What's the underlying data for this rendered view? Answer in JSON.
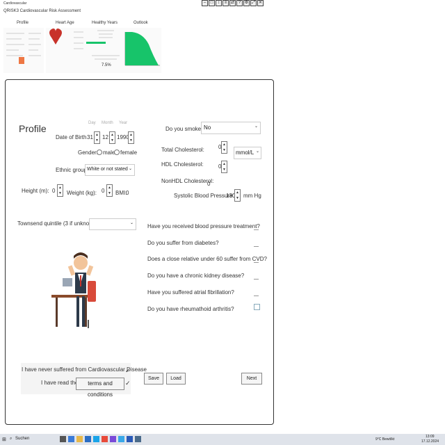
{
  "window": {
    "title": "Cardiovascular",
    "subtitle": "QRISK3 Cardiovascular Risk Assessment"
  },
  "thumbnails": [
    {
      "label": "Profile"
    },
    {
      "label": "Heart Age"
    },
    {
      "label": "Healthy Years"
    },
    {
      "label": "Outlook"
    }
  ],
  "healthy_years_value": "7.5%",
  "profile": {
    "title": "Profile",
    "dob_label": "Date of Birth",
    "day_label": "Day",
    "month_label": "Month",
    "year_label": "Year",
    "day": "31",
    "month": "12",
    "year": "1990",
    "gender_label": "Gender:",
    "gender_male": "male",
    "gender_female": "female",
    "ethnic_label": "Ethnic group",
    "ethnic_value": "White or not stated",
    "height_label": "Height (m):",
    "height_value": "0",
    "weight_label": "Weight (kg):",
    "weight_value": "0",
    "bmi_label": "BMI:",
    "bmi_value": "0",
    "townsend_label": "Townsend quintile (3 if unknown):",
    "smoke_label": "Do you smoke?",
    "smoke_value": "No",
    "total_chol_label": "Total Cholesterol:",
    "total_chol_value": "0",
    "unit_value": "mmol/L",
    "hdl_label": "HDL Cholesterol:",
    "hdl_value": "0",
    "nonhdl_label": "NonHDL Cholesterol:",
    "nonhdl_value": "0",
    "sbp_label": "Systolic Blood Pressure:",
    "sbp_value": "130",
    "sbp_unit": "mm Hg"
  },
  "questions": [
    "Have you received blood pressure treatment?",
    "Do you suffer from diabetes?",
    "Does a close relative under 60 suffer from CVD?",
    "Do you have a chronic kidney disease?",
    "Have you suffered atrial fibrillation?",
    "Do you have rheumathoid arthritis?"
  ],
  "consent": {
    "never_suffered": "I have never suffered from Cardiovascular Disease",
    "have_read": "I have read the",
    "terms_button": "terms and conditions"
  },
  "buttons": {
    "save": "Save",
    "load": "Load",
    "next": "Next"
  },
  "taskbar": {
    "search": "Suchen",
    "weather": "9°C Bewölkt",
    "time": "13:09",
    "date": "17.12.2024"
  },
  "colors": {
    "accent_green": "#17c46a",
    "heart_red": "#c8322a"
  }
}
